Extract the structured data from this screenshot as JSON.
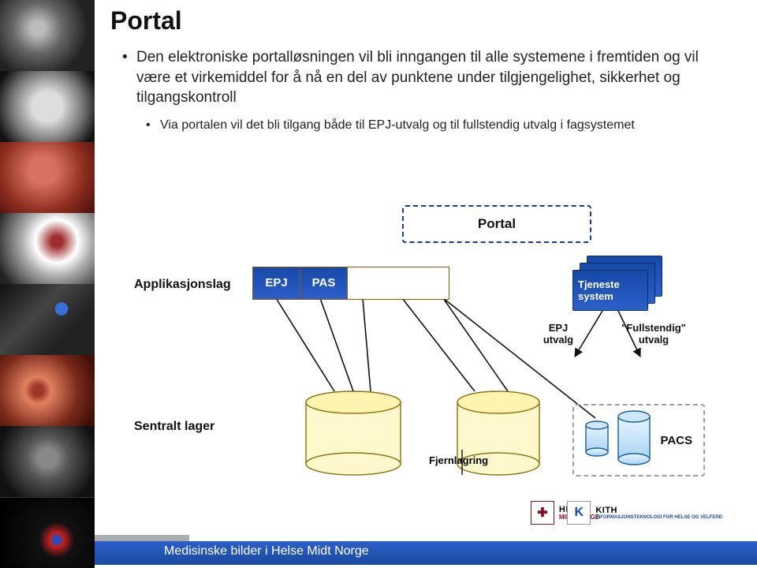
{
  "title": "Portal",
  "bullets": {
    "b1": "Den elektroniske portalløsningen vil bli inngangen til alle systemene i fremtiden og vil være et virkemiddel for å nå en del av punktene under tilgjengelighet, sikkerhet og tilgangskontroll",
    "sub1": "Via portalen vil det bli tilgang både til EPJ-utvalg og til fullstendig utvalg i fagsystemet"
  },
  "diagram": {
    "portal": "Portal",
    "applikasjonslag": "Applikasjonslag",
    "epj": "EPJ",
    "pas": "PAS",
    "tjeneste_l1": "Tjeneste",
    "tjeneste_l2": "system",
    "arrow_epj_l1": "EPJ",
    "arrow_epj_l2": "utvalg",
    "arrow_full_l1": "\"Fullstendig\"",
    "arrow_full_l2": "utvalg",
    "sentralt_lager": "Sentralt lager",
    "fjernlagring": "Fjernlagring",
    "pacs": "PACS"
  },
  "footer": {
    "text": "Medisinske bilder i Helse Midt Norge"
  },
  "logos": {
    "l1a": "HELSE",
    "l1b": "MIDT-NORGE",
    "l2a": "KITH",
    "l2b": "INFORMASJONSTEKNOLOGI FOR HELSE OG VELFERD"
  }
}
